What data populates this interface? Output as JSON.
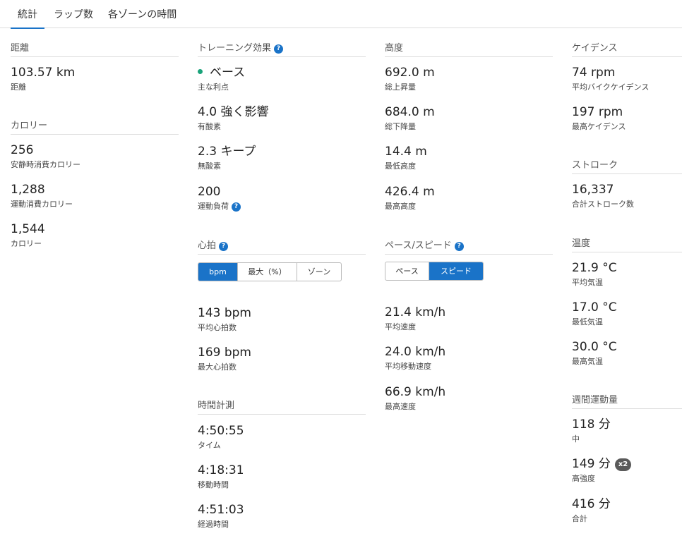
{
  "tabs": [
    "統計",
    "ラップ数",
    "各ゾーンの時間"
  ],
  "colors": {
    "accent": "#1a73c8",
    "primary_benefit_dot": "#1aa37a",
    "badge": "#5a5a5a"
  },
  "distance": {
    "title": "距離",
    "value": "103.57 km",
    "label": "距離"
  },
  "calories": {
    "title": "カロリー",
    "stats": [
      {
        "value": "256",
        "label": "安静時消費カロリー"
      },
      {
        "value": "1,288",
        "label": "運動消費カロリー"
      },
      {
        "value": "1,544",
        "label": "カロリー"
      }
    ]
  },
  "training_effect": {
    "title": "トレーニング効果",
    "help_icon": "?",
    "primary": {
      "value": "ベース",
      "label": "主な利点"
    },
    "aerobic": {
      "value": "4.0 強く影響",
      "label": "有酸素"
    },
    "anaerobic": {
      "value": "2.3 キープ",
      "label": "無酸素"
    },
    "load": {
      "value": "200",
      "label": "運動負荷"
    }
  },
  "heart_rate": {
    "title": "心拍",
    "help_icon": "?",
    "toggle": [
      "bpm",
      "最大（%）",
      "ゾーン"
    ],
    "toggle_selected": "bpm",
    "stats": [
      {
        "value": "143 bpm",
        "label": "平均心拍数"
      },
      {
        "value": "169 bpm",
        "label": "最大心拍数"
      }
    ]
  },
  "timing": {
    "title": "時間計測",
    "stats": [
      {
        "value": "4:50:55",
        "label": "タイム"
      },
      {
        "value": "4:18:31",
        "label": "移動時間"
      },
      {
        "value": "4:51:03",
        "label": "経過時間"
      }
    ]
  },
  "elevation": {
    "title": "高度",
    "stats": [
      {
        "value": "692.0 m",
        "label": "総上昇量"
      },
      {
        "value": "684.0 m",
        "label": "総下降量"
      },
      {
        "value": "14.4 m",
        "label": "最低高度"
      },
      {
        "value": "426.4 m",
        "label": "最高高度"
      }
    ]
  },
  "pace_speed": {
    "title": "ペース/スピード",
    "help_icon": "?",
    "toggle": [
      "ペース",
      "スピード"
    ],
    "toggle_selected": "スピード",
    "stats": [
      {
        "value": "21.4 km/h",
        "label": "平均速度"
      },
      {
        "value": "24.0 km/h",
        "label": "平均移動速度"
      },
      {
        "value": "66.9 km/h",
        "label": "最高速度"
      }
    ]
  },
  "cadence": {
    "title": "ケイデンス",
    "stats": [
      {
        "value": "74 rpm",
        "label": "平均バイクケイデンス"
      },
      {
        "value": "197 rpm",
        "label": "最高ケイデンス"
      }
    ]
  },
  "strokes": {
    "title": "ストローク",
    "value": "16,337",
    "label": "合計ストローク数"
  },
  "temperature": {
    "title": "温度",
    "stats": [
      {
        "value": "21.9 °C",
        "label": "平均気温"
      },
      {
        "value": "17.0 °C",
        "label": "最低気温"
      },
      {
        "value": "30.0 °C",
        "label": "最高気温"
      }
    ]
  },
  "intensity_minutes": {
    "title": "週間運動量",
    "moderate": {
      "value": "118 分",
      "label": "中"
    },
    "vigorous": {
      "value": "149 分",
      "badge": "x2",
      "label": "高強度"
    },
    "total": {
      "value": "416 分",
      "label": "合計"
    }
  }
}
